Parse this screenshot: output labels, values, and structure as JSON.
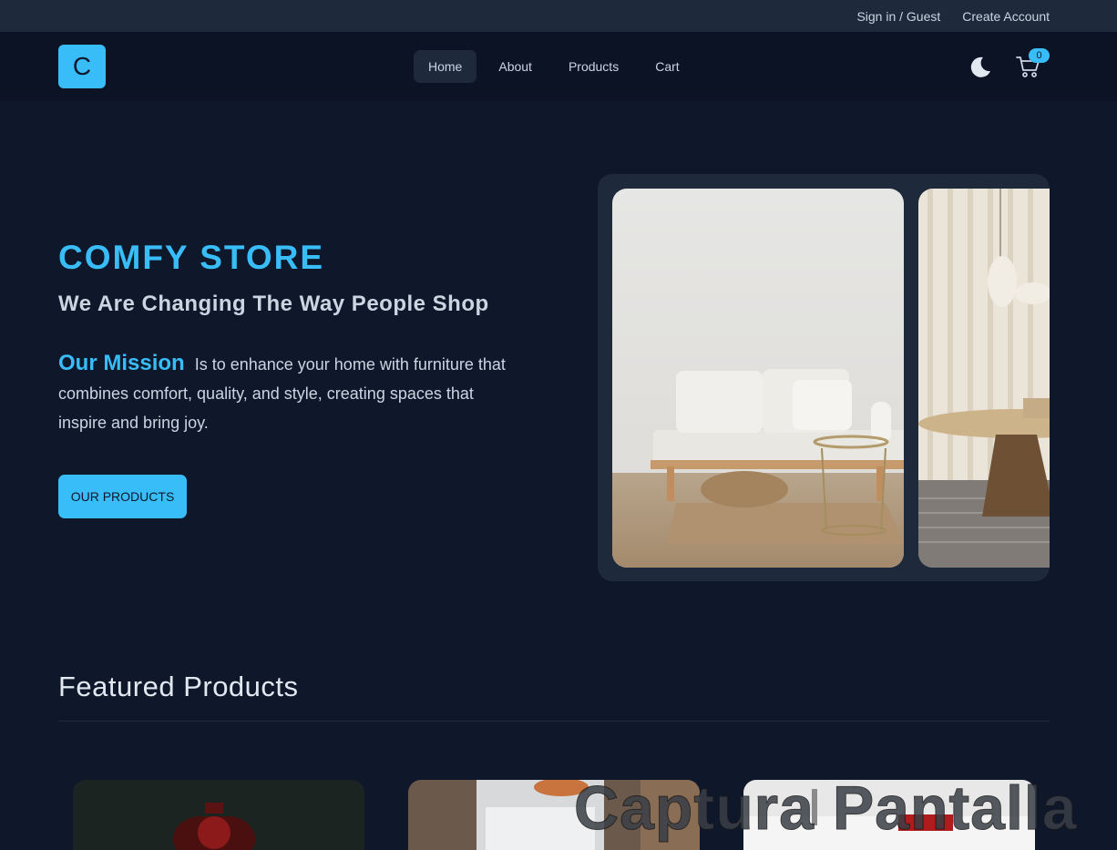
{
  "topbar": {
    "signin": "Sign in / Guest",
    "create": "Create Account"
  },
  "nav": {
    "logo": "C",
    "links": [
      "Home",
      "About",
      "Products",
      "Cart"
    ],
    "active": "Home",
    "cart_count": "0"
  },
  "hero": {
    "title": "COMFY STORE",
    "subtitle": "We Are Changing The Way People Shop",
    "mission_label": "Our Mission",
    "mission_text": "Is to enhance your home with furniture that combines comfort, quality, and style, creating spaces that inspire and bring joy.",
    "cta": "OUR PRODUCTS"
  },
  "featured": {
    "title": "Featured Products"
  },
  "watermark": "Captura Pantalla",
  "colors": {
    "accent": "#38bdf8",
    "background": "#0f172a",
    "surface": "#1e293b"
  }
}
